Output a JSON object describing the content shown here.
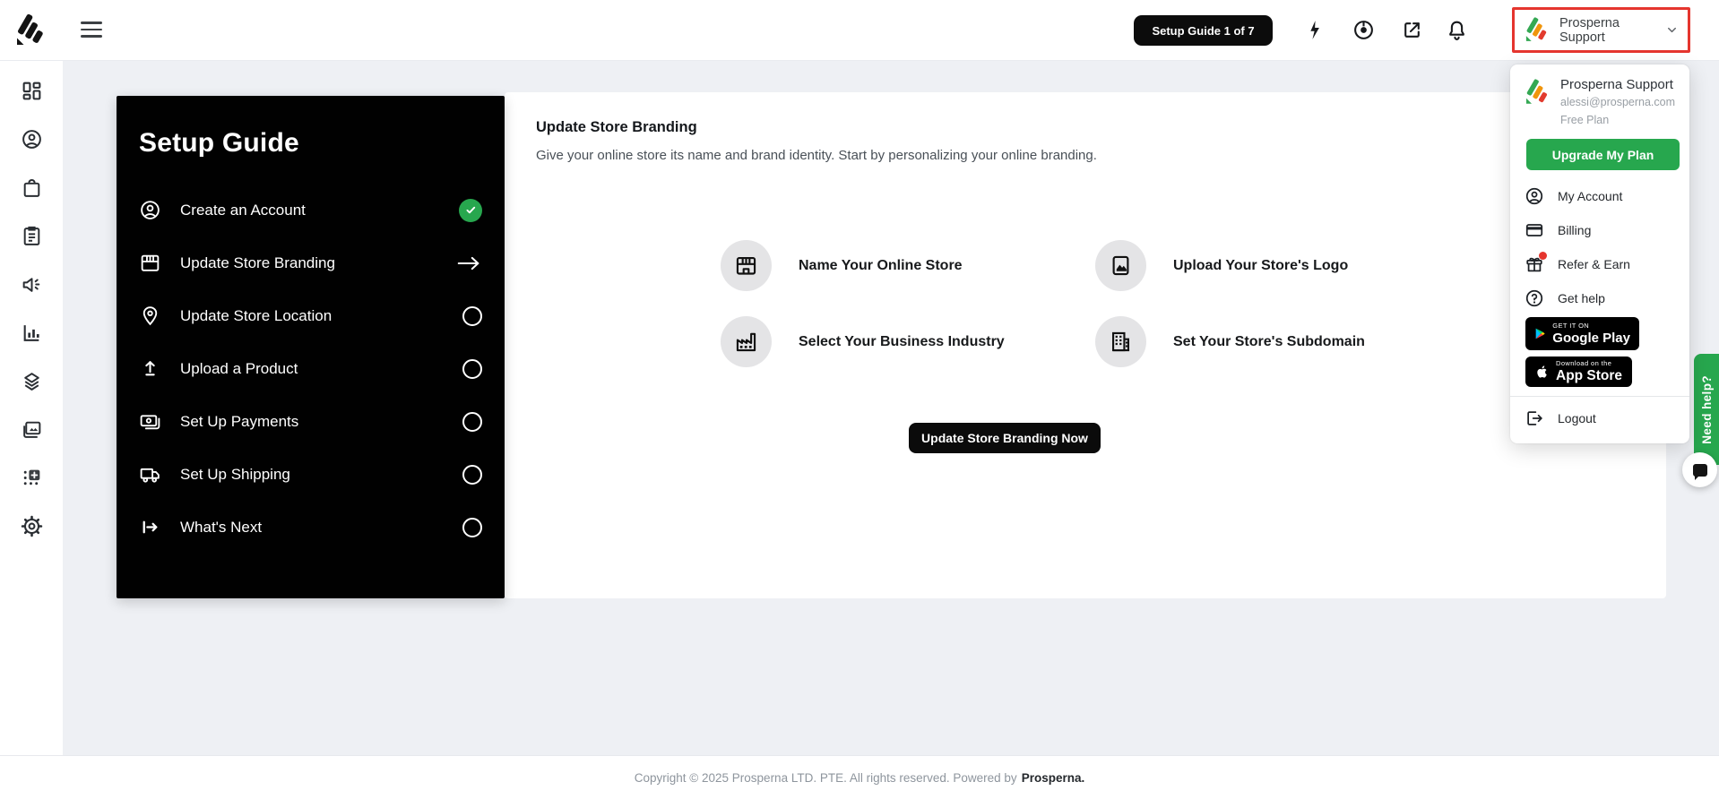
{
  "topbar": {
    "setup_pill": "Setup Guide 1 of 7",
    "account_label": "Prosperna Support",
    "icons": [
      "menu",
      "lightning",
      "goal-disc",
      "open-store-external",
      "notifications-bell",
      "chevron-down"
    ]
  },
  "sidebar": {
    "icons": [
      "dashboard",
      "customers",
      "orders",
      "products",
      "marketing",
      "analytics",
      "integrations",
      "media",
      "apps",
      "settings"
    ]
  },
  "setup_guide": {
    "title": "Setup Guide",
    "items": [
      {
        "label": "Create an Account",
        "icon": "user-circle",
        "status": "complete"
      },
      {
        "label": "Update Store Branding",
        "icon": "storefront",
        "status": "current"
      },
      {
        "label": "Update Store Location",
        "icon": "map-pin",
        "status": "pending"
      },
      {
        "label": "Upload a Product",
        "icon": "upload",
        "status": "pending"
      },
      {
        "label": "Set Up Payments",
        "icon": "payments",
        "status": "pending"
      },
      {
        "label": "Set Up Shipping",
        "icon": "truck",
        "status": "pending"
      },
      {
        "label": "What's Next",
        "icon": "arrow-from-bar",
        "status": "pending"
      }
    ]
  },
  "main": {
    "heading": "Update Store Branding",
    "description": "Give your online store its name and brand identity. Start by personalizing your online branding.",
    "features": [
      {
        "label": "Name Your Online Store",
        "icon": "storefront"
      },
      {
        "label": "Upload Your Store's Logo",
        "icon": "image"
      },
      {
        "label": "Select Your Business Industry",
        "icon": "factory"
      },
      {
        "label": "Set Your Store's Subdomain",
        "icon": "office-building"
      }
    ],
    "cta_label": "Update Store Branding Now"
  },
  "account_menu": {
    "name": "Prosperna Support",
    "email": "alessi@prosperna.com",
    "plan": "Free Plan",
    "upgrade_label": "Upgrade My Plan",
    "items": [
      {
        "label": "My Account",
        "icon": "user-circle"
      },
      {
        "label": "Billing",
        "icon": "credit-card"
      },
      {
        "label": "Refer & Earn",
        "icon": "gift",
        "badge": "unread-dot"
      },
      {
        "label": "Get help",
        "icon": "help-circle"
      }
    ],
    "google_play_badge": {
      "top": "GET IT ON",
      "bottom": "Google Play"
    },
    "app_store_badge": {
      "top": "Download on the",
      "bottom": "App Store"
    },
    "logout_label": "Logout"
  },
  "help_widget": {
    "tab_label": "Need help?"
  },
  "footer": {
    "text": "Copyright © 2025 Prosperna LTD. PTE. All rights reserved. Powered by",
    "brand": "Prosperna."
  },
  "colors": {
    "accent_green": "#27a74e",
    "alert_red": "#e5352e",
    "logo_green": "#34a853",
    "logo_orange": "#f0950c",
    "logo_red": "#e23b2e",
    "panel_black": "#010101",
    "page_bg": "#eef0f4"
  }
}
